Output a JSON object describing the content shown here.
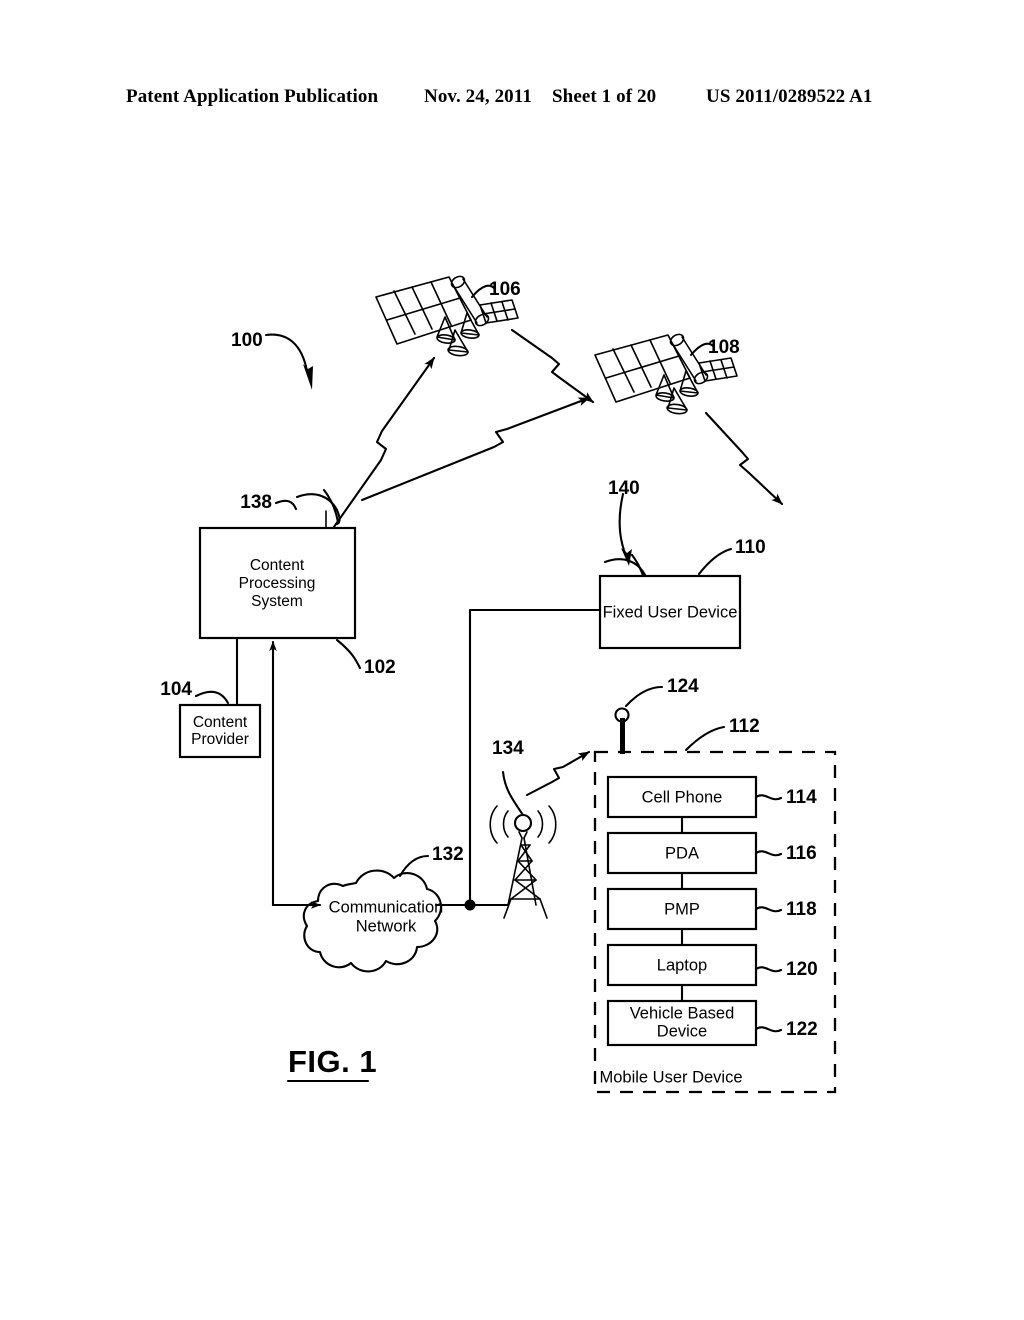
{
  "header": {
    "title": "Patent Application Publication",
    "date": "Nov. 24, 2011",
    "sheet": "Sheet 1 of 20",
    "doc_number": "US 2011/0289522 A1"
  },
  "figure": {
    "caption": "FIG. 1",
    "system_ref": "100"
  },
  "nodes": {
    "content_processing_system": {
      "label_line1": "Content",
      "label_line2": "Processing",
      "label_line3": "System",
      "ref": "102"
    },
    "content_provider": {
      "label_line1": "Content",
      "label_line2": "Provider",
      "ref": "104"
    },
    "satellite_1": {
      "ref": "106"
    },
    "satellite_2": {
      "ref": "108"
    },
    "fixed_user_device": {
      "label": "Fixed User Device",
      "ref": "110"
    },
    "mobile_user_device": {
      "label": "Mobile User Device",
      "ref": "112"
    },
    "communication_network": {
      "label_line1": "Communication",
      "label_line2": "Network",
      "ref": "132"
    },
    "cell_tower": {
      "ref": "134"
    },
    "cps_dish_antenna": {
      "ref": "138"
    },
    "fixed_device_dish_antenna": {
      "ref": "140"
    },
    "mobile_device_antenna": {
      "ref": "124"
    }
  },
  "mobile_devices": [
    {
      "label": "Cell Phone",
      "ref": "114"
    },
    {
      "label": "PDA",
      "ref": "116"
    },
    {
      "label": "PMP",
      "ref": "118"
    },
    {
      "label": "Laptop",
      "ref": "120"
    },
    {
      "label_line1": "Vehicle Based",
      "label_line2": "Device",
      "ref": "122"
    }
  ],
  "colors": {
    "ink": "#000000",
    "paper": "#ffffff"
  }
}
